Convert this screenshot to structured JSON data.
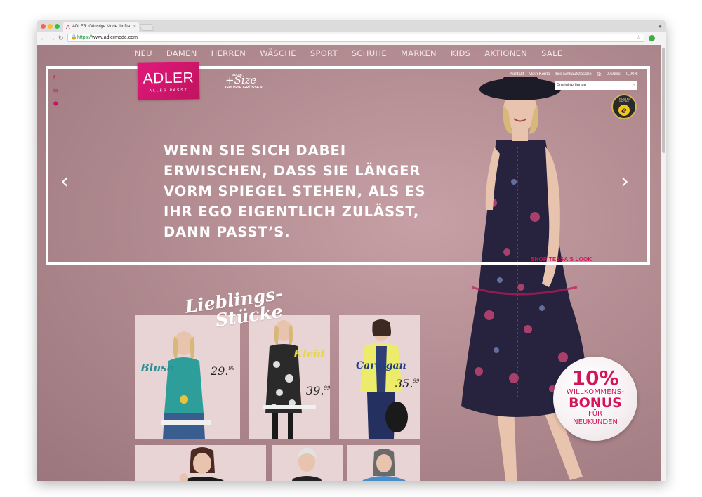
{
  "browser": {
    "tab_title": "ADLER: Günstige Mode für Da",
    "tab_close": "×",
    "url_prefix": "https://",
    "url_host": "www.adlermode.com",
    "back": "←",
    "forward": "→",
    "reload": "↻"
  },
  "nav": {
    "items": [
      "NEU",
      "DAMEN",
      "HERREN",
      "WÄSCHE",
      "SPORT",
      "SCHUHE",
      "MARKEN",
      "KIDS",
      "AKTIONEN",
      "SALE"
    ]
  },
  "brand": {
    "logo": "ADLER",
    "tagline": "ALLES PASST",
    "plus_size_brand": "ADLER",
    "plus_size_title": "+Size",
    "plus_size_sub": "GROSSE GRÖSSEN"
  },
  "social": {
    "facebook": "f",
    "mail": "✉",
    "location": "⬤"
  },
  "utility": {
    "contact": "Kontakt",
    "account": "Mein Konto",
    "wishlist": "Ihre Einkaufstasche",
    "cart_count": "0 Artikel",
    "cart_total": "0,00 €",
    "search_placeholder": "Produkte finden"
  },
  "trusted": {
    "ring": "TRUSTED SHOPS",
    "mark": "e"
  },
  "hero": {
    "headline_lines": [
      "WENN SIE SICH DABEI",
      "ERWISCHEN, DASS SIE LÄNGER",
      "VORM SPIEGEL STEHEN, ALS ES",
      "IHR EGO EIGENTLICH ZULÄSST,",
      "DANN PASST’S."
    ],
    "prev_arrow": "‹",
    "next_arrow": "›",
    "shop_look": "SHOP TESSA'S LOOK"
  },
  "favorites": {
    "title_line1": "Lieblings-",
    "title_line2": "Stücke",
    "cards": [
      {
        "label": "Bluse",
        "price_main": "29.",
        "price_cents": "99",
        "label_color": "#2a8f94"
      },
      {
        "label": "Kleid",
        "price_main": "39.",
        "price_cents": "99",
        "label_color": "#e4d84a"
      },
      {
        "label": "Cardigan",
        "price_main": "35.",
        "price_cents": "99",
        "label_color": "#1f3c8a"
      }
    ]
  },
  "bonus": {
    "percent": "10%",
    "line1": "WILLKOMMENS-",
    "line2": "BONUS",
    "line3": "FÜR",
    "line4": "NEUKUNDEN"
  },
  "colors": {
    "brand_pink": "#d4145a",
    "background": "#b28c91"
  }
}
